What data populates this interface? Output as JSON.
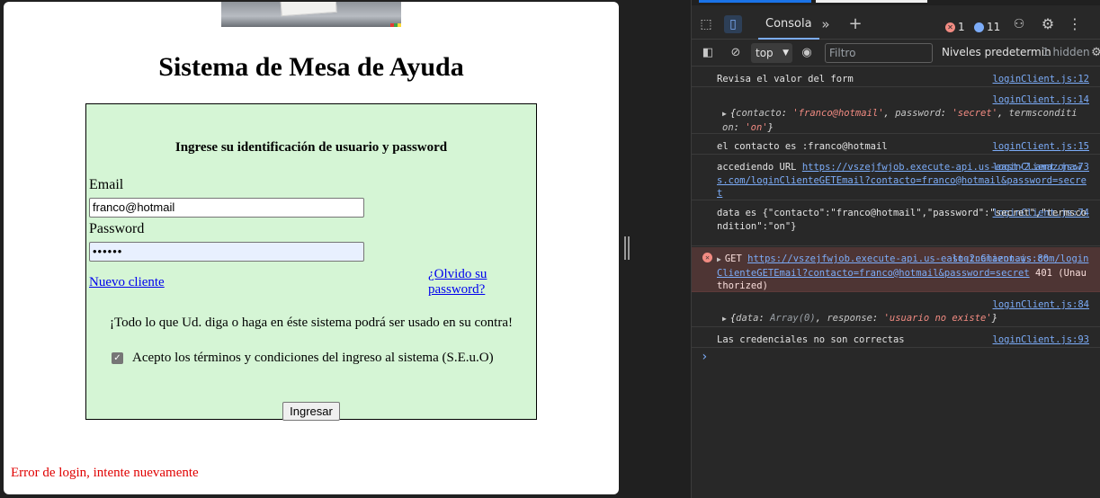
{
  "page": {
    "title": "Sistema de Mesa de Ayuda",
    "form": {
      "heading": "Ingrese su identificación de usuario y password",
      "email_label": "Email",
      "email_value": "franco@hotmail",
      "password_label": "Password",
      "password_masked": "••••••",
      "new_client_link": "Nuevo cliente",
      "forgot_link_line1": "¿Olvido su",
      "forgot_link_line2": "password?",
      "warning": "¡Todo lo que Ud. diga o haga en éste sistema podrá ser usado en su contra!",
      "terms_checked": true,
      "terms_label": "Acepto los términos y condiciones del ingreso al sistema (S.E.u.O)",
      "submit_label": "Ingresar"
    },
    "error_message": "Error de login, intente nuevamente"
  },
  "devtools": {
    "tabs": {
      "console_label": "Consola"
    },
    "error_count": "1",
    "info_count": "11",
    "toolbar": {
      "context": "top",
      "filter_placeholder": "Filtro",
      "levels": "Niveles predetermin",
      "hidden": "1 hidden"
    },
    "icons": {
      "inspect": "inspect-icon",
      "device": "device-toolbar-icon",
      "more": "chevron-double-right-icon",
      "add": "plus-icon",
      "error": "error-icon",
      "info": "info-icon",
      "share": "share-icon",
      "settings": "gear-icon",
      "menu": "kebab-icon"
    },
    "colors": {
      "link": "#7cacf8",
      "error_bg": "#4e3534",
      "error": "#f28b82",
      "page_error_text": "#e00000",
      "form_bg": "#d5f5d5"
    },
    "console": {
      "m1": {
        "text": "Revisa el valor del form",
        "src": "loginClient.js:12"
      },
      "m2": {
        "src": "loginClient.js:14",
        "k1": "contacto",
        "v1": "'franco@hotmail'",
        "k2": "password",
        "v2": "'secret'",
        "k3": "termsconditi",
        "k3b": "on",
        "v3": "'on'"
      },
      "m3": {
        "text": "el contacto es :franco@hotmail",
        "src": "loginClient.js:15"
      },
      "m4": {
        "prefix": "accediendo URL ",
        "url": "https://vszejfwjob.execute-api.us-east-2.amazonaws.com/loginClienteGETEmail?contacto=franco@hotmail&password=secret",
        "src": "loginClient.js:73"
      },
      "m5": {
        "text": "data es {\"contacto\":\"franco@hotmail\",\"password\":\"secret\",\"termscondition\":\"on\"}",
        "src": "loginClient.js:74"
      },
      "m6": {
        "method": "GET",
        "url": "https://vszejfwjob.execute-api.us-east-2.amazonaws.com/loginClienteGETEmail?contacto=franco@hotmail&password=secret",
        "status": "401 (Unauthorized)",
        "src": "loginClient.js:80"
      },
      "m7": {
        "src": "loginClient.js:84",
        "k1": "data",
        "v1": "Array(0)",
        "k2": "response",
        "v2": "'usuario no existe'"
      },
      "m8": {
        "text": "Las credenciales no son correctas",
        "src": "loginClient.js:93"
      }
    }
  }
}
